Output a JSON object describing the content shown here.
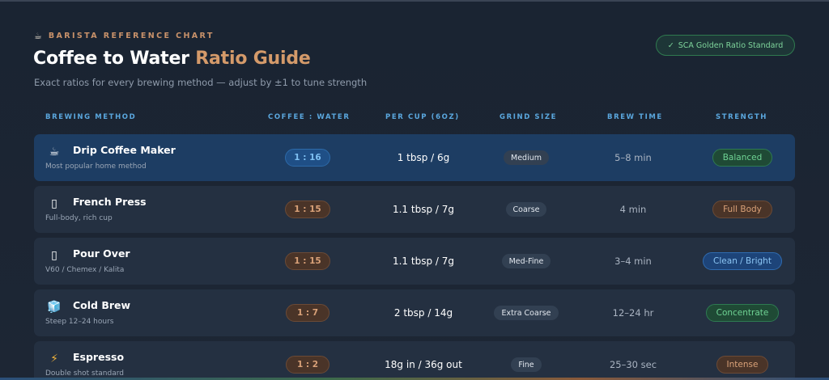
{
  "header": {
    "eyebrow_icon": "☕",
    "eyebrow": "BARISTA REFERENCE CHART",
    "title_main": "Coffee to Water ",
    "title_accent": "Ratio Guide",
    "subtitle": "Exact ratios for every brewing method — adjust by ±1 to tune strength",
    "badge_check": "✓",
    "badge": "SCA Golden Ratio Standard"
  },
  "columns": {
    "method": "BREWING METHOD",
    "ratio": "COFFEE : WATER",
    "per_cup": "PER CUP (6OZ)",
    "grind": "GRIND SIZE",
    "time": "BREW TIME",
    "strength": "STRENGTH"
  },
  "rows": [
    {
      "icon": "☕",
      "icon_name": "coffee-cup-icon",
      "name": "Drip Coffee Maker",
      "desc": "Most popular home method",
      "ratio": "1 : 16",
      "per_cup": "1 tbsp / 6g",
      "grind": "Medium",
      "time": "5–8 min",
      "strength": "Balanced"
    },
    {
      "icon": "▯",
      "icon_name": "french-press-icon",
      "name": "French Press",
      "desc": "Full-body, rich cup",
      "ratio": "1 : 15",
      "per_cup": "1.1 tbsp / 7g",
      "grind": "Coarse",
      "time": "4 min",
      "strength": "Full Body"
    },
    {
      "icon": "▯",
      "icon_name": "pour-over-icon",
      "name": "Pour Over",
      "desc": "V60 / Chemex / Kalita",
      "ratio": "1 : 15",
      "per_cup": "1.1 tbsp / 7g",
      "grind": "Med-Fine",
      "time": "3–4 min",
      "strength": "Clean / Bright"
    },
    {
      "icon": "🧊",
      "icon_name": "ice-cube-icon",
      "name": "Cold Brew",
      "desc": "Steep 12–24 hours",
      "ratio": "1 : 7",
      "per_cup": "2 tbsp / 14g",
      "grind": "Extra Coarse",
      "time": "12–24 hr",
      "strength": "Concentrate"
    },
    {
      "icon": "⚡",
      "icon_name": "lightning-icon",
      "name": "Espresso",
      "desc": "Double shot standard",
      "ratio": "1 : 2",
      "per_cup": "18g in / 36g out",
      "grind": "Fine",
      "time": "25–30 sec",
      "strength": "Intense"
    }
  ]
}
